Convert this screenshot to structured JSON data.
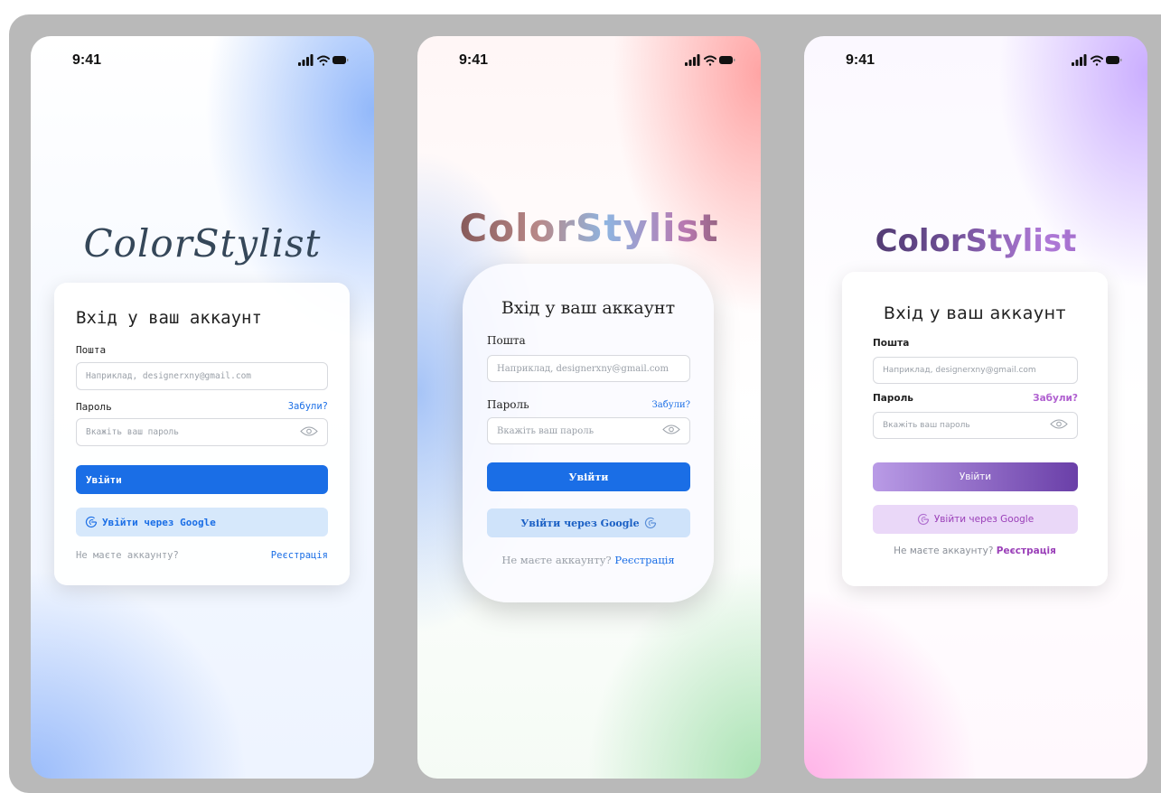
{
  "status_time": "9:41",
  "logo": "ColorStylist",
  "title": "Вхід у ваш аккаунт",
  "email_label": "Пошта",
  "email_placeholder": "Наприклад, designerxny@gmail.com",
  "password_label": "Пароль",
  "forgot_link": "Забули?",
  "password_placeholder": "Вкажіть ваш пароль",
  "login_button": "Увійти",
  "google_button": "Увійти через Google",
  "no_account_text": "Не маєте аккаунту?",
  "register_link": "Реєстрація",
  "colors": {
    "primary_blue": "#1a6ee6",
    "google_blue_bg": "#d6e8fb",
    "purple_button": "#7a52bd",
    "purple_google_bg": "#ead8f8",
    "purple_link": "#9a3fb8"
  },
  "icons": [
    "cellular-signal-icon",
    "wifi-icon",
    "battery-icon",
    "eye-icon",
    "google-icon"
  ]
}
